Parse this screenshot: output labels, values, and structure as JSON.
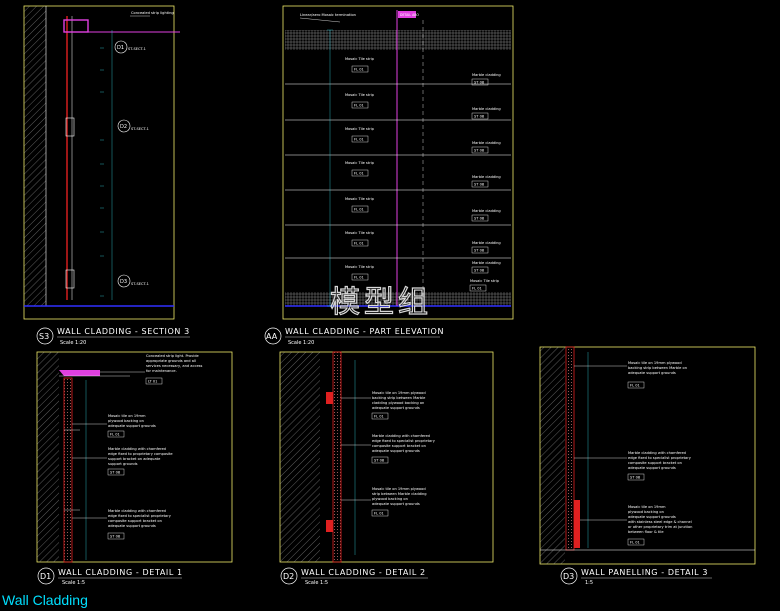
{
  "page_title": "Wall Cladding",
  "watermark": "模型组",
  "colors": {
    "frame": "#f0ea6a",
    "red": "#e02020",
    "magenta": "#e040e0",
    "cyan": "#30d0e0",
    "white": "#ffffff",
    "blue": "#3030ff"
  },
  "section3": {
    "tag": "S3",
    "title": "WALL CLADDING - SECTION 3",
    "scale": "Scale 1:20",
    "notes": [
      "Concealed strip lighting"
    ],
    "callouts": [
      {
        "id": "D1",
        "ref": "ST-SECT-1"
      },
      {
        "id": "D2",
        "ref": "ST-SECT-1"
      },
      {
        "id": "D3",
        "ref": "ST-SECT-1"
      }
    ]
  },
  "elevation": {
    "tag": "AA",
    "title": "WALL CLADDING - PART ELEVATION",
    "scale": "Scale 1:20",
    "top_label": "Linear/aero Mosaic termination",
    "top_badge": "DETAIL ABO",
    "left_labels": [
      {
        "text": "Mosaic Tile strip",
        "code": "FL 01"
      },
      {
        "text": "Mosaic Tile strip",
        "code": "FL 01"
      },
      {
        "text": "Mosaic Tile strip",
        "code": "FL 01"
      },
      {
        "text": "Mosaic Tile strip",
        "code": "FL 01"
      },
      {
        "text": "Mosaic Tile strip",
        "code": "FL 01"
      },
      {
        "text": "Mosaic Tile strip",
        "code": "FL 01"
      },
      {
        "text": "Mosaic Tile strip",
        "code": "FL 01"
      }
    ],
    "right_labels": [
      {
        "text": "Marble cladding",
        "code": "ST 08"
      },
      {
        "text": "Marble cladding",
        "code": "ST 08"
      },
      {
        "text": "Marble cladding",
        "code": "ST 08"
      },
      {
        "text": "Marble cladding",
        "code": "ST 08"
      },
      {
        "text": "Marble cladding",
        "code": "ST 08"
      },
      {
        "text": "Marble cladding",
        "code": "ST 08"
      },
      {
        "text": "Marble cladding",
        "code": "ST 08"
      },
      {
        "text": "Mosaic Tile strip",
        "code": "FL 01"
      }
    ]
  },
  "detail1": {
    "tag": "D1",
    "title": "WALL CLADDING - DETAIL 1",
    "scale": "Scale 1:5",
    "notes": [
      {
        "lines": [
          "Concealed strip light. Provide",
          "appropriate grounds and all",
          "services necessary, and access",
          "for maintenance."
        ],
        "code": "LT 01"
      },
      {
        "lines": [
          "Mosaic tile on 19mm",
          "plywood backing on",
          "adequate support grounds"
        ],
        "code": "FL 01"
      },
      {
        "lines": [
          "Marble cladding with chamfered",
          "edge fixed to proprietary composite",
          "support bracket on adequate",
          "support grounds"
        ],
        "code": "ST 08"
      },
      {
        "lines": [
          "Marble cladding with chamfered",
          "edge fixed to specialist proprietary",
          "composite support bracket on",
          "adequate support grounds"
        ],
        "code": "ST 08"
      }
    ]
  },
  "detail2": {
    "tag": "D2",
    "title": "WALL CLADDING - DETAIL 2",
    "scale": "Scale 1:5",
    "notes": [
      {
        "lines": [
          "Mosaic tile on 19mm plywood",
          "backing strip between Marble",
          "cladding plywood backing on",
          "adequate support grounds"
        ],
        "code": "FL 01"
      },
      {
        "lines": [
          "Marble cladding with chamfered",
          "edge fixed to specialist proprietary",
          "composite support bracket on",
          "adequate support grounds"
        ],
        "code": "ST 08"
      },
      {
        "lines": [
          "Mosaic tile on 19mm plywood",
          "strip between Marble cladding",
          "plywood backing on",
          "adequate support grounds"
        ],
        "code": "FL 01"
      }
    ]
  },
  "detail3": {
    "tag": "D3",
    "title": "WALL PANELLING - DETAIL 3",
    "scale": "1:5",
    "notes": [
      {
        "lines": [
          "Mosaic tile on 19mm plywood",
          "backing strip between Marble on",
          "adequate support grounds"
        ],
        "code": "FL 01"
      },
      {
        "lines": [
          "Marble cladding with chamfered",
          "edge fixed to specialist proprietary",
          "composite support bracket on",
          "adequate support grounds"
        ],
        "code": "ST 08"
      },
      {
        "lines": [
          "Mosaic tile on 19mm",
          "plywood backing on",
          "adequate support grounds",
          "with stainless steel edge & channel",
          "or other proprietary trim at junction",
          "between floor & tile"
        ],
        "code": "FL 01"
      }
    ]
  }
}
